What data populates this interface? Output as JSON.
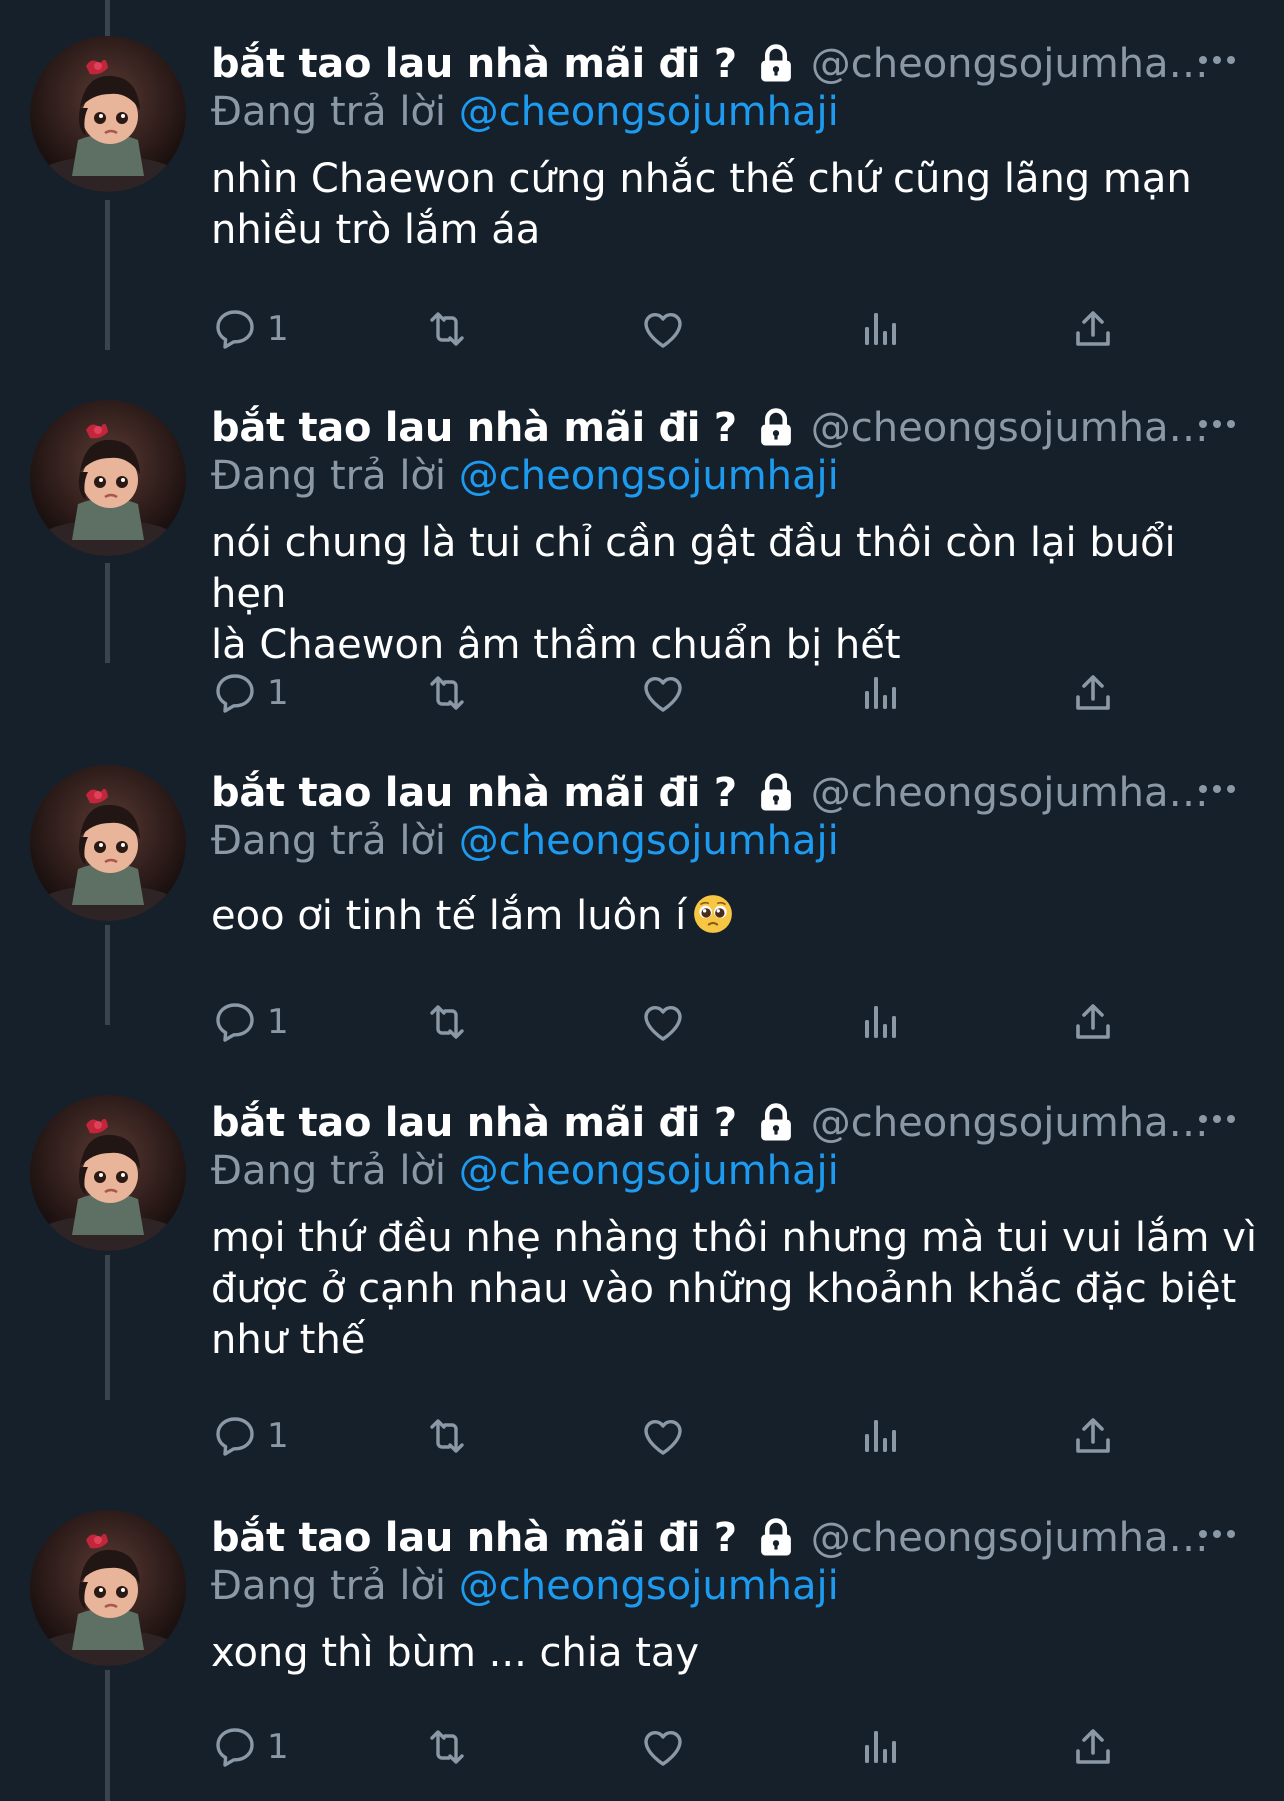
{
  "author": {
    "display_name": "bắt tao lau nhà mãi đi ?",
    "handle": "@cheongsojumhaji...",
    "replying_prefix": "Đang trả lời",
    "replying_to": "@cheongsojumhaji"
  },
  "tweets": [
    {
      "text_lines": [
        "nhìn Chaewon cứng nhắc thế chứ cũng lãng mạn",
        "nhiều trò lắm áa"
      ],
      "reply_count": "1"
    },
    {
      "text_lines": [
        "nói chung là tui chỉ cần gật đầu thôi còn lại buổi hẹn",
        "là Chaewon âm thầm chuẩn bị hết"
      ],
      "reply_count": "1"
    },
    {
      "text_lines": [
        "eoo ơi tinh tế lắm luôn í"
      ],
      "emoji": "pleading-face",
      "reply_count": "1"
    },
    {
      "text_lines": [
        "mọi thứ đều nhẹ nhàng thôi nhưng mà tui vui lắm vì",
        "được ở cạnh nhau vào những khoảnh khắc đặc biệt",
        "như thế"
      ],
      "reply_count": "1"
    },
    {
      "text_lines": [
        "xong thì bùm ... chia tay"
      ],
      "reply_count": "1"
    }
  ],
  "colors": {
    "background": "#15202b",
    "thread_line": "#3a444c",
    "secondary_text": "#8b98a5",
    "accent": "#1d9bf0"
  },
  "icons": [
    "lock-icon",
    "more-icon",
    "reply-icon",
    "retweet-icon",
    "like-icon",
    "views-icon",
    "share-icon",
    "avatar"
  ]
}
